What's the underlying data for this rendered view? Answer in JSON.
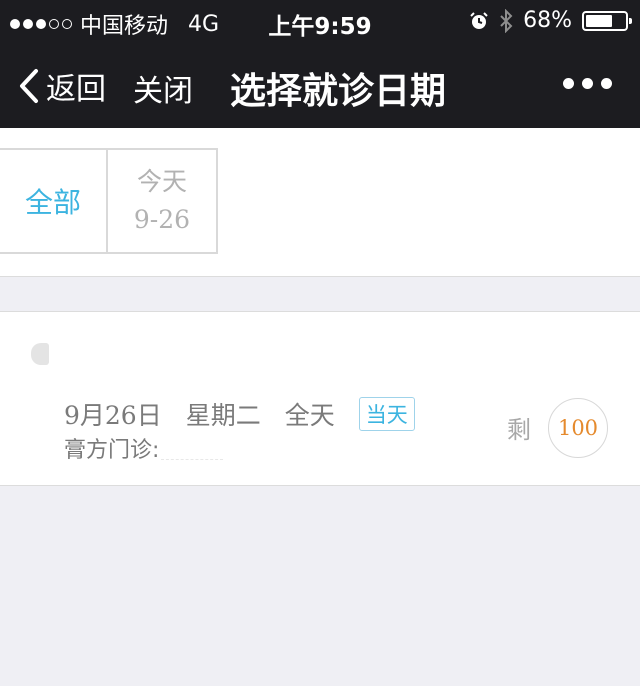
{
  "status_bar": {
    "carrier": "中国移动",
    "network": "4G",
    "time": "上午9:59",
    "battery": "68%",
    "battery_level": 0.68,
    "signal_bars": 3,
    "signal_total": 5,
    "icons": [
      "alarm-icon",
      "bluetooth-icon",
      "battery-icon"
    ]
  },
  "nav": {
    "back_label": "返回",
    "close_label": "关闭",
    "title": "选择就诊日期",
    "more_icon": "more-dots-icon"
  },
  "filters": {
    "all_label": "全部",
    "today_label": "今天",
    "today_date": "9-26"
  },
  "schedule": {
    "date": "9月26日",
    "weekday": "星期二",
    "session": "全天",
    "badge": "当天",
    "clinic_label": "膏方门诊:",
    "clinic_value": "",
    "remain_label": "剩",
    "remain_count": "100"
  },
  "colors": {
    "header_bg": "#1c1c20",
    "accent": "#3cb4e0",
    "count": "#e58a2d",
    "page_bg": "#efeff4"
  }
}
